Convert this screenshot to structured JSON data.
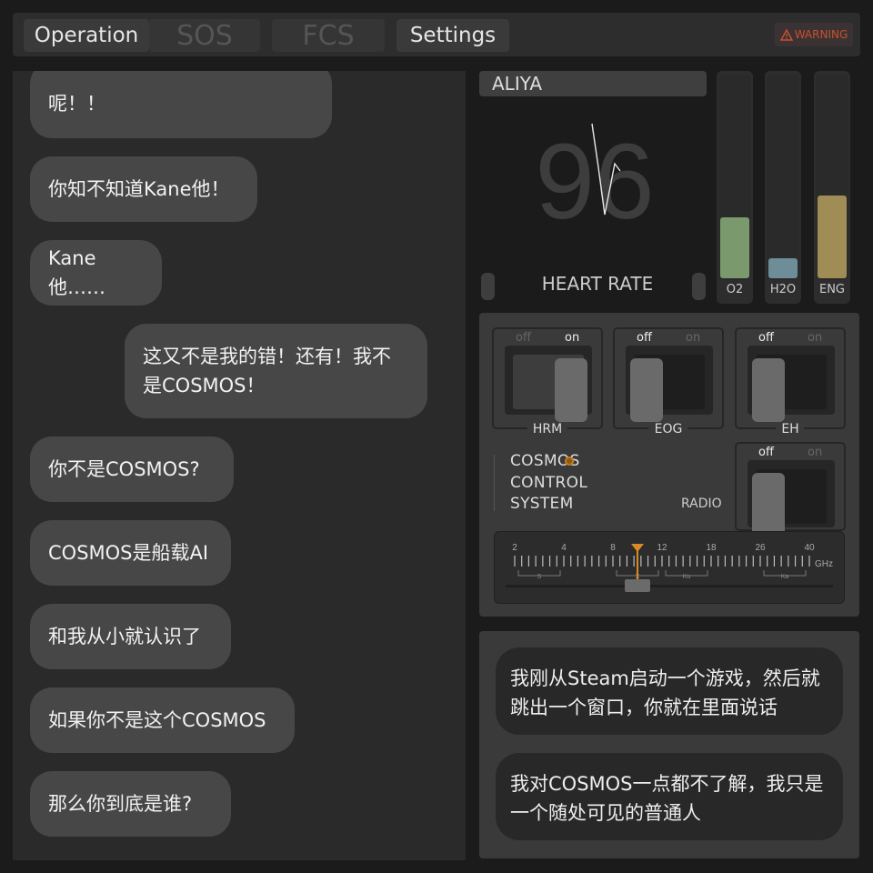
{
  "tabs": [
    {
      "label": "Operation",
      "state": "active"
    },
    {
      "label": "SOS",
      "state": "disabled"
    },
    {
      "label": "FCS",
      "state": "disabled"
    },
    {
      "label": "Settings",
      "state": "active"
    }
  ],
  "warning": {
    "label": "WARNING",
    "color": "#c9502f"
  },
  "chat": {
    "bubbles": [
      {
        "text": "呢！！",
        "side": "left"
      },
      {
        "text": "你知不知道Kane他！",
        "side": "left"
      },
      {
        "text": "Kane他……",
        "side": "left"
      },
      {
        "text": "这又不是我的错！还有！我不是COSMOS！",
        "side": "right"
      },
      {
        "text": "你不是COSMOS?",
        "side": "left"
      },
      {
        "text": "COSMOS是船载AI",
        "side": "left"
      },
      {
        "text": "和我从小就认识了",
        "side": "left"
      },
      {
        "text": "如果你不是这个COSMOS",
        "side": "left"
      },
      {
        "text": "那么你到底是谁?",
        "side": "left"
      }
    ]
  },
  "vitals": {
    "name": "ALIYA",
    "heart_rate": "96",
    "heart_rate_label": "HEART RATE",
    "gauges": [
      {
        "label": "O2",
        "level": 0.3,
        "color": "#7a9a6e"
      },
      {
        "label": "H2O",
        "level": 0.1,
        "color": "#6d8d98"
      },
      {
        "label": "ENG",
        "level": 0.41,
        "color": "#a08d55"
      }
    ]
  },
  "controls": {
    "switches": [
      {
        "name": "HRM",
        "off": "off",
        "on": "on",
        "state": "on"
      },
      {
        "name": "EOG",
        "off": "off",
        "on": "on",
        "state": "off"
      },
      {
        "name": "EH",
        "off": "off",
        "on": "on",
        "state": "off"
      }
    ],
    "radio_switch": {
      "name": "RADIO",
      "off": "off",
      "on": "on",
      "state": "off"
    },
    "system_title": [
      "COSMOS",
      "CONTROL",
      "SYSTEM"
    ],
    "dial": {
      "ticks": [
        "2",
        "4",
        "8",
        "12",
        "18",
        "26",
        "40"
      ],
      "unit": "GHz",
      "bands": [
        "S",
        "X",
        "Ku",
        "Ka"
      ],
      "value": 10
    }
  },
  "messages": [
    {
      "text": "我刚从Steam启动一个游戏，然后就跳出一个窗口，你就在里面说话"
    },
    {
      "text": "我对COSMOS一点都不了解，我只是一个随处可见的普通人"
    }
  ]
}
